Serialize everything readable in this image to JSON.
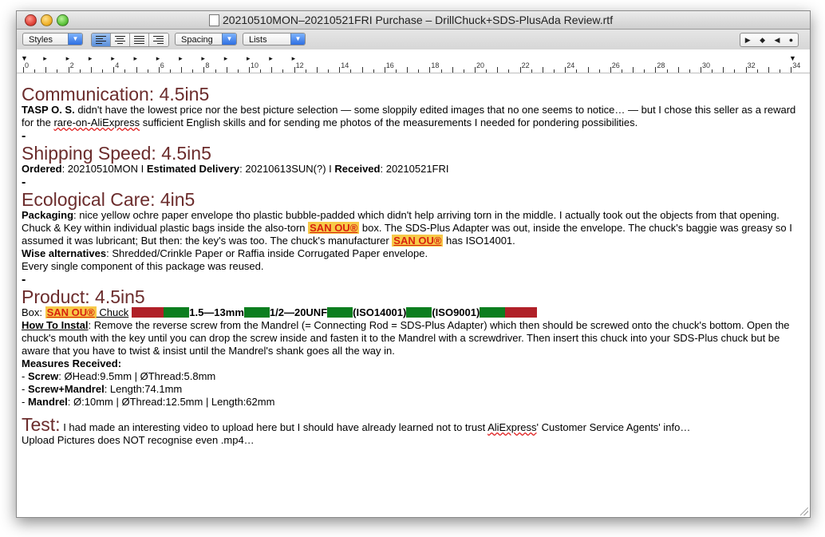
{
  "window": {
    "title": "20210510MON–20210521FRI Purchase – DrillChuck+SDS-PlusAda Review.rtf"
  },
  "toolbar": {
    "styles_label": "Styles",
    "spacing_label": "Spacing",
    "lists_label": "Lists",
    "align_buttons": [
      "align-left",
      "align-center",
      "align-justify",
      "align-right"
    ]
  },
  "ruler": {
    "labels": [
      "0",
      "2",
      "4",
      "6",
      "8",
      "10",
      "12",
      "14",
      "16",
      "18",
      "20",
      "22",
      "24",
      "26",
      "28",
      "30",
      "32",
      "34"
    ]
  },
  "colors": {
    "heading": "#6b2c2c",
    "brand_bg": "#f7c948",
    "brand_text": "#d8210f",
    "red_block": "#b02028",
    "green_block": "#0c7e1f"
  },
  "doc": {
    "communication": {
      "heading": "Communication: 4.5in5",
      "seller": "TASP O. S.",
      "text1": " didn't have the lowest price nor the best picture selection — some sloppily edited images that no one seems to notice… — but I chose this seller as a reward for the ",
      "link": "rare-on-AliExpress",
      "text2": " sufficient English skills and for sending me photos of the measurements I needed for pondering possibilities."
    },
    "separator": "-",
    "shipping": {
      "heading": "Shipping Speed: 4.5in5",
      "ordered_label": "Ordered",
      "ordered_value": ": 20210510MON I ",
      "estimated_label": "Estimated Delivery",
      "estimated_value": ": 20210613SUN(?) I ",
      "received_label": "Received",
      "received_value": ": 20210521FRI"
    },
    "ecological": {
      "heading": "Ecological Care: 4in5",
      "packaging_label": "Packaging",
      "packaging_text1": ": nice yellow ochre paper envelope tho plastic bubble-padded which didn't help arriving torn in the middle. I actually took out the objects from that opening. Chuck & Key within individual plastic bags inside the also-torn ",
      "brand": "SAN OU®",
      "packaging_text2": " box. The SDS-Plus Adapter was out, inside the envelope. The chuck's baggie was greasy so I assumed it was lubricant; But then: the key's was too. The chuck's manufacturer ",
      "packaging_text3": " has ISO14001.",
      "wise_label": "Wise alternatives",
      "wise_text": ": Shredded/Crinkle Paper or Raffia inside Corrugated Paper envelope.",
      "reused": "Every single component of this package was reused."
    },
    "product": {
      "heading": "Product: 4.5in5",
      "box_label": "Box: ",
      "brand": "SAN OU®",
      "chuck_word": " Chuck",
      "spec1": "1.5—13mm",
      "spec2": "1/2—20UNF",
      "spec3": "(ISO14001)",
      "spec4": "(ISO9001)",
      "how_label": "How To Instal",
      "how_text": ": Remove the reverse screw from the Mandrel (= Connecting Rod = SDS-Plus Adapter) which then should be screwed onto the chuck's bottom. Open the chuck's mouth with the key until you can drop the screw inside and fasten it to the Mandrel with a screwdriver. Then insert this chuck into your SDS-Plus chuck but be aware that you have to twist & insist until the Mandrel's shank goes all the way in.",
      "measures_label": "Measures Received",
      "measures_colon": ":",
      "items": [
        {
          "prefix": "- ",
          "label": "Screw",
          "value": ": ØHead:9.5mm | ØThread:5.8mm"
        },
        {
          "prefix": "- ",
          "label": "Screw+Mandrel",
          "value": ": Length:74.1mm"
        },
        {
          "prefix": "- ",
          "label": "Mandrel",
          "value": ": Ø:10mm | ØThread:12.5mm | Length:62mm"
        }
      ]
    },
    "test": {
      "label": "Test:",
      "text1": " I had made an interesting video to upload here but I should have already learned not to trust ",
      "link": "AliExpress",
      "text2": "' Customer Service Agents' info…",
      "line2": "Upload Pictures does NOT recognise even .mp4…"
    }
  }
}
